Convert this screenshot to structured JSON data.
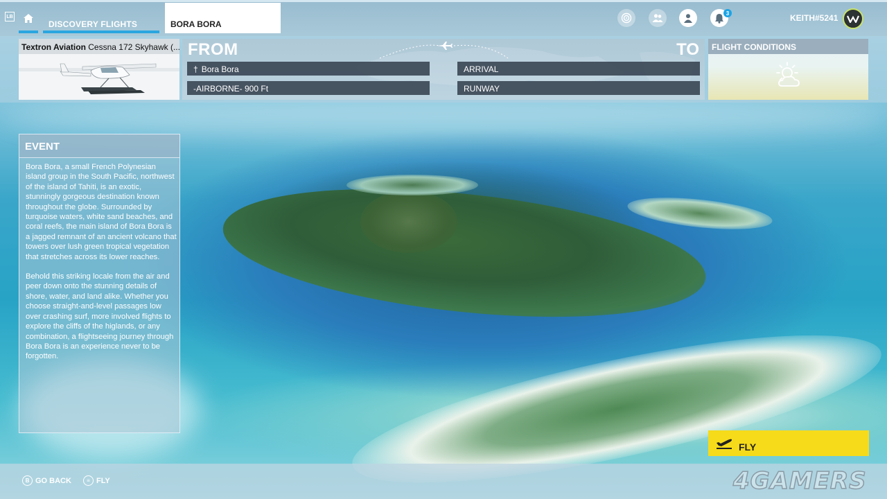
{
  "header": {
    "lb_key": "LB",
    "tabs": [
      {
        "label": "DISCOVERY FLIGHTS"
      },
      {
        "label": "BORA BORA"
      }
    ],
    "notification_count": "3",
    "username": "KEITH#5241"
  },
  "aircraft": {
    "maker": "Textron Aviation",
    "model": "Cessna 172 Skyhawk (..."
  },
  "route": {
    "from_label": "FROM",
    "to_label": "TO",
    "from_location": "Bora Bora",
    "from_detail": "-AIRBORNE- 900 Ft",
    "to_location": "ARRIVAL",
    "to_detail": "RUNWAY"
  },
  "conditions": {
    "title": "FLIGHT CONDITIONS"
  },
  "event": {
    "title": "EVENT",
    "paragraphs": [
      "Bora Bora, a small French Polynesian island group in the South Pacific, northwest of the island of Tahiti, is an exotic, stunningly gorgeous destination known throughout the globe. Surrounded by turquoise waters, white sand beaches, and coral reefs, the main island of Bora Bora is a jagged remnant of an ancient volcano that towers over lush green tropical vegetation that stretches across its lower reaches.",
      "Behold this striking locale from the air and peer down onto the stunning details of shore, water, and land alike. Whether you choose straight-and-level passages low over crashing surf, more involved flights to explore the cliffs of the higlands, or any combination, a flightseeing journey through Bora Bora is an experience never to be forgotten."
    ]
  },
  "actions": {
    "fly_label": "FLY"
  },
  "footer": {
    "hints": [
      {
        "key": "B",
        "label": "GO BACK"
      },
      {
        "key": "≡",
        "label": "FLY"
      }
    ],
    "watermark": "4GAMERS"
  },
  "colors": {
    "accent": "#2aa6e0",
    "fly_button": "#f6db1a",
    "field_bg": "#3c4856"
  }
}
